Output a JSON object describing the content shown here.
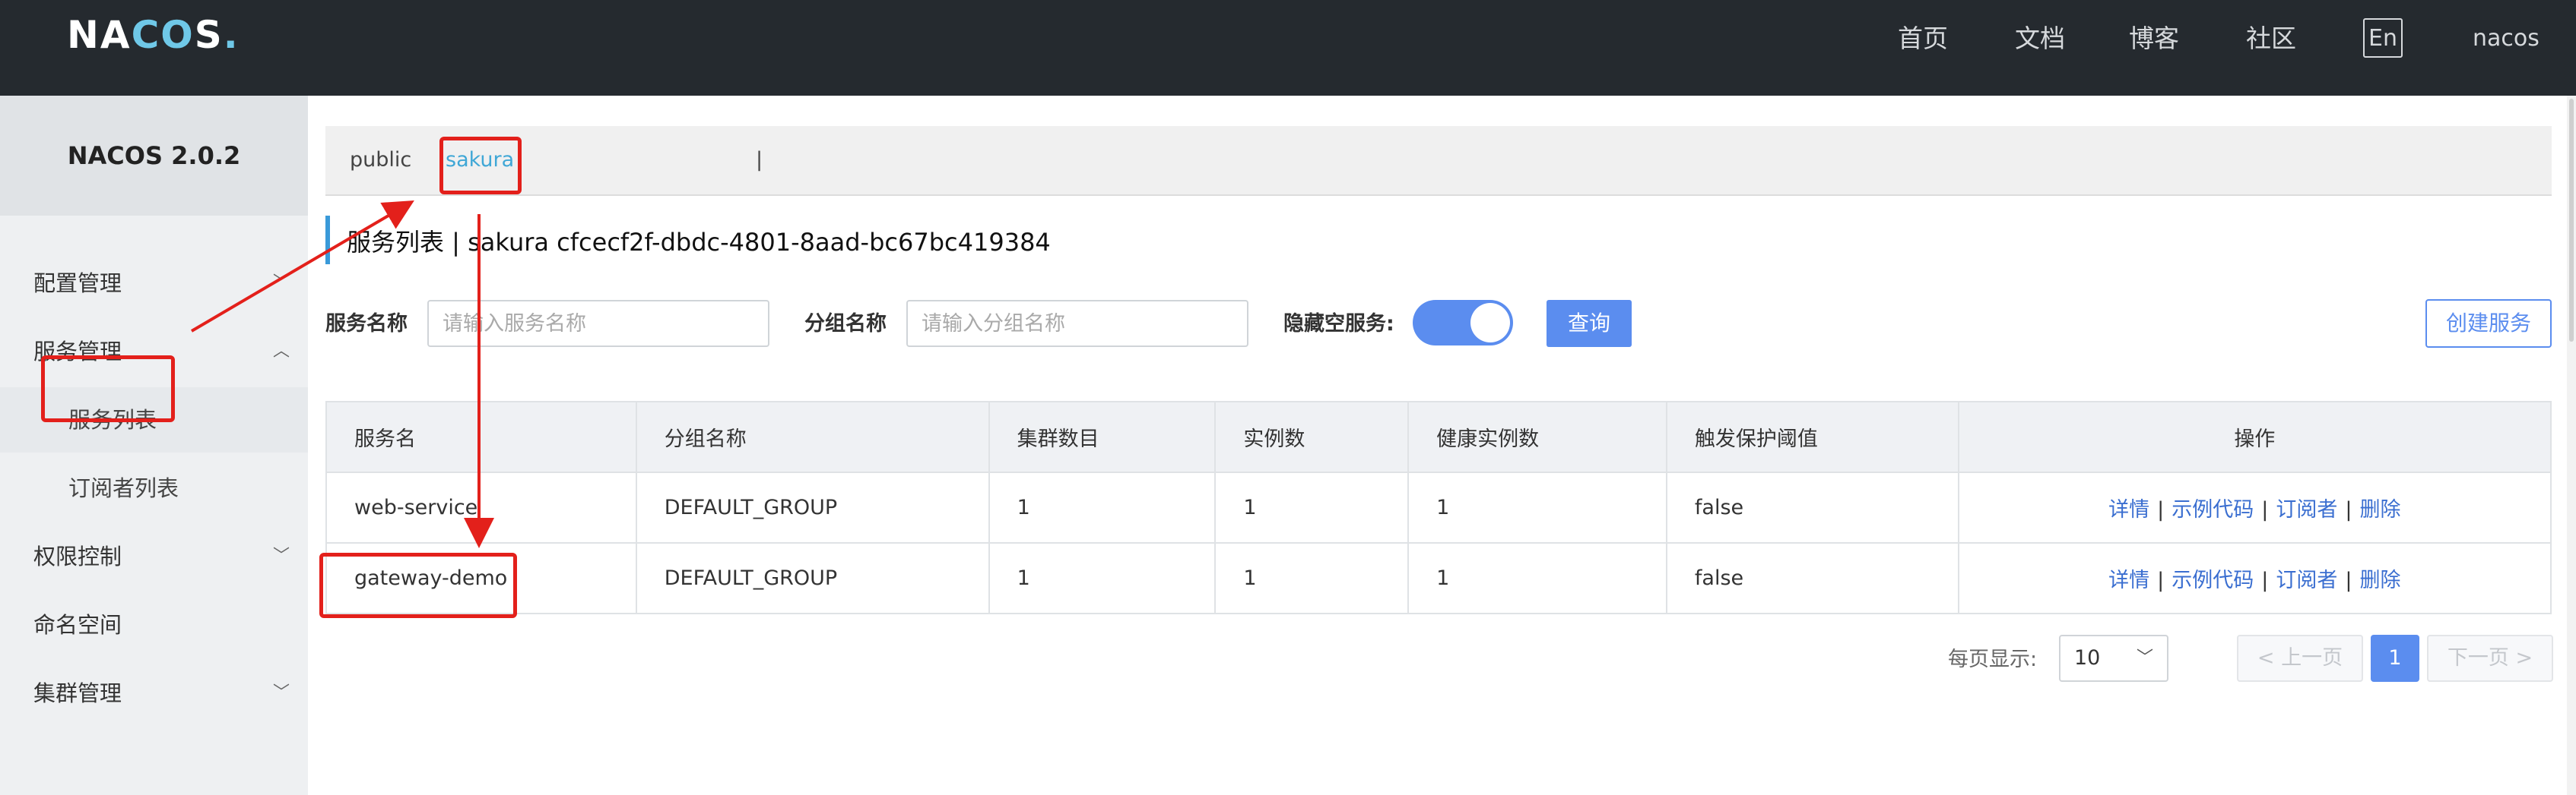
{
  "header": {
    "logo": "NACOS.",
    "nav": [
      "首页",
      "文档",
      "博客",
      "社区"
    ],
    "lang": "En",
    "user": "nacos"
  },
  "sidebar": {
    "title": "NACOS 2.0.2",
    "items": [
      {
        "label": "配置管理",
        "expandable": true,
        "expanded": false
      },
      {
        "label": "服务管理",
        "expandable": true,
        "expanded": true
      },
      {
        "label": "服务列表",
        "sub": true,
        "active": true
      },
      {
        "label": "订阅者列表",
        "sub": true
      },
      {
        "label": "权限控制",
        "expandable": true,
        "expanded": false
      },
      {
        "label": "命名空间"
      },
      {
        "label": "集群管理",
        "expandable": true,
        "expanded": false
      }
    ]
  },
  "namespace_tabs": {
    "tabs": [
      "public",
      "sakura"
    ],
    "separator": "|",
    "active": "sakura"
  },
  "page": {
    "title": "服务列表 | sakura cfcecf2f-dbdc-4801-8aad-bc67bc419384"
  },
  "filters": {
    "service_name_label": "服务名称",
    "service_name_placeholder": "请输入服务名称",
    "group_name_label": "分组名称",
    "group_name_placeholder": "请输入分组名称",
    "hide_empty_label": "隐藏空服务:",
    "hide_empty_enabled": true,
    "query_button": "查询",
    "create_button": "创建服务"
  },
  "table": {
    "columns": [
      "服务名",
      "分组名称",
      "集群数目",
      "实例数",
      "健康实例数",
      "触发保护阈值",
      "操作"
    ],
    "rows": [
      {
        "name": "web-service",
        "group": "DEFAULT_GROUP",
        "clusters": "1",
        "instances": "1",
        "healthy": "1",
        "protect": "false"
      },
      {
        "name": "gateway-demo",
        "group": "DEFAULT_GROUP",
        "clusters": "1",
        "instances": "1",
        "healthy": "1",
        "protect": "false"
      }
    ],
    "ops": {
      "detail": "详情",
      "sample": "示例代码",
      "subscribers": "订阅者",
      "delete": "删除",
      "sep": "|"
    }
  },
  "pagination": {
    "page_size_label": "每页显示:",
    "page_size": "10",
    "prev": "< 上一页",
    "next": "下一页 >",
    "current": "1"
  },
  "colors": {
    "topbar": "#252a2f",
    "accent": "#5b8def",
    "link": "#3a6ed0",
    "annotation": "#e3201b"
  }
}
